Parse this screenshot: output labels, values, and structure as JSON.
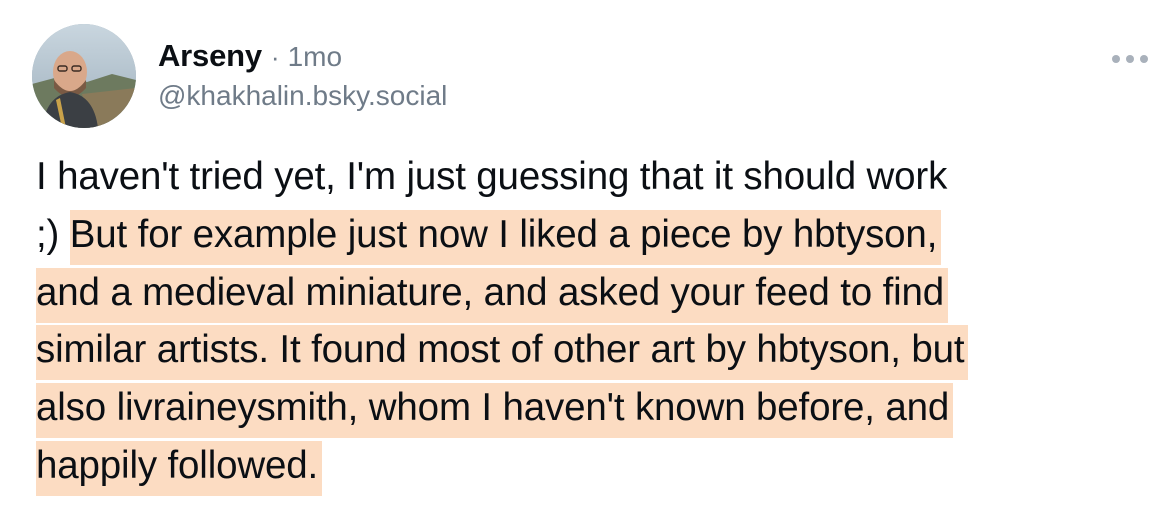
{
  "post": {
    "author": {
      "display_name": "Arseny",
      "handle": "@khakhalin.bsky.social"
    },
    "separator": "·",
    "timestamp": "1mo",
    "body_lines": [
      {
        "plain": "I haven't tried yet, I'm just guessing that it should work",
        "highlighted": ""
      },
      {
        "plain": ";) ",
        "highlighted": "But for example just now I liked a piece by hbtyson,"
      },
      {
        "plain": "",
        "highlighted": "and a medieval miniature, and asked your feed to find"
      },
      {
        "plain": "",
        "highlighted": "similar artists. It found most of other art by hbtyson, but"
      },
      {
        "plain": "",
        "highlighted": "also livraineysmith, whom I haven't known before, and"
      },
      {
        "plain": "",
        "highlighted": "happily followed."
      }
    ],
    "more_icon": "horizontal-ellipsis-icon"
  },
  "colors": {
    "highlight": "#fcdcc2",
    "text": "#0b0f14",
    "muted": "#6f7b88"
  }
}
